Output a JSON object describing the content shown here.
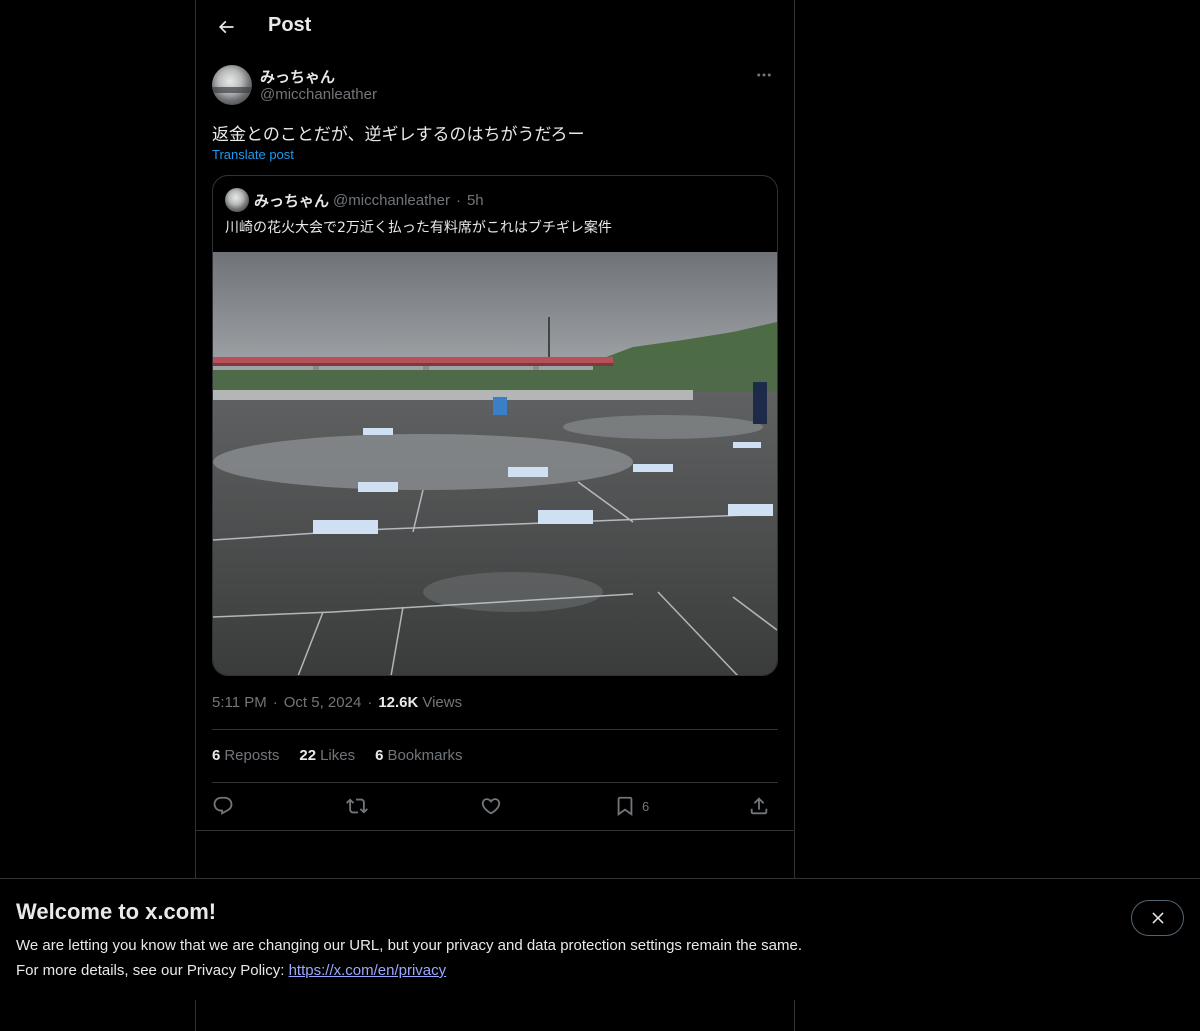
{
  "header": {
    "title": "Post",
    "back_icon": "arrow-left-icon"
  },
  "author": {
    "display_name": "みっちゃん",
    "handle": "@micchanleather",
    "more_icon": "ellipsis-icon"
  },
  "post": {
    "text": "返金とのことだが、逆ギレするのはちがうだろー",
    "translate_label": "Translate post"
  },
  "quoted_post": {
    "display_name": "みっちゃん",
    "handle": "@micchanleather",
    "separator": "·",
    "time": "5h",
    "text": "川崎の花火大会で2万近く払った有料席がこれはブチギレ案件",
    "media": "photo-icon"
  },
  "meta": {
    "time": "5:11 PM",
    "separator": "·",
    "date": "Oct 5, 2024",
    "views_count": "12.6K",
    "views_label": "Views"
  },
  "stats": {
    "reposts_count": "6",
    "reposts_label": "Reposts",
    "likes_count": "22",
    "likes_label": "Likes",
    "bookmarks_count": "6",
    "bookmarks_label": "Bookmarks"
  },
  "actions": {
    "reply_icon": "reply-icon",
    "repost_icon": "repost-icon",
    "like_icon": "heart-icon",
    "bookmark_icon": "bookmark-icon",
    "bookmark_count": "6",
    "share_icon": "share-icon"
  },
  "banner": {
    "title": "Welcome to x.com!",
    "line1": "We are letting you know that we are changing our URL, but your privacy and data protection settings remain the same.",
    "line2_prefix": "For more details, see our Privacy Policy: ",
    "link_text": "https://x.com/en/privacy",
    "close_icon": "close-icon"
  },
  "colors": {
    "background": "#000000",
    "text": "#e7e9ea",
    "secondary": "#71767b",
    "accent": "#1d9bf0",
    "border": "#2f3336"
  }
}
